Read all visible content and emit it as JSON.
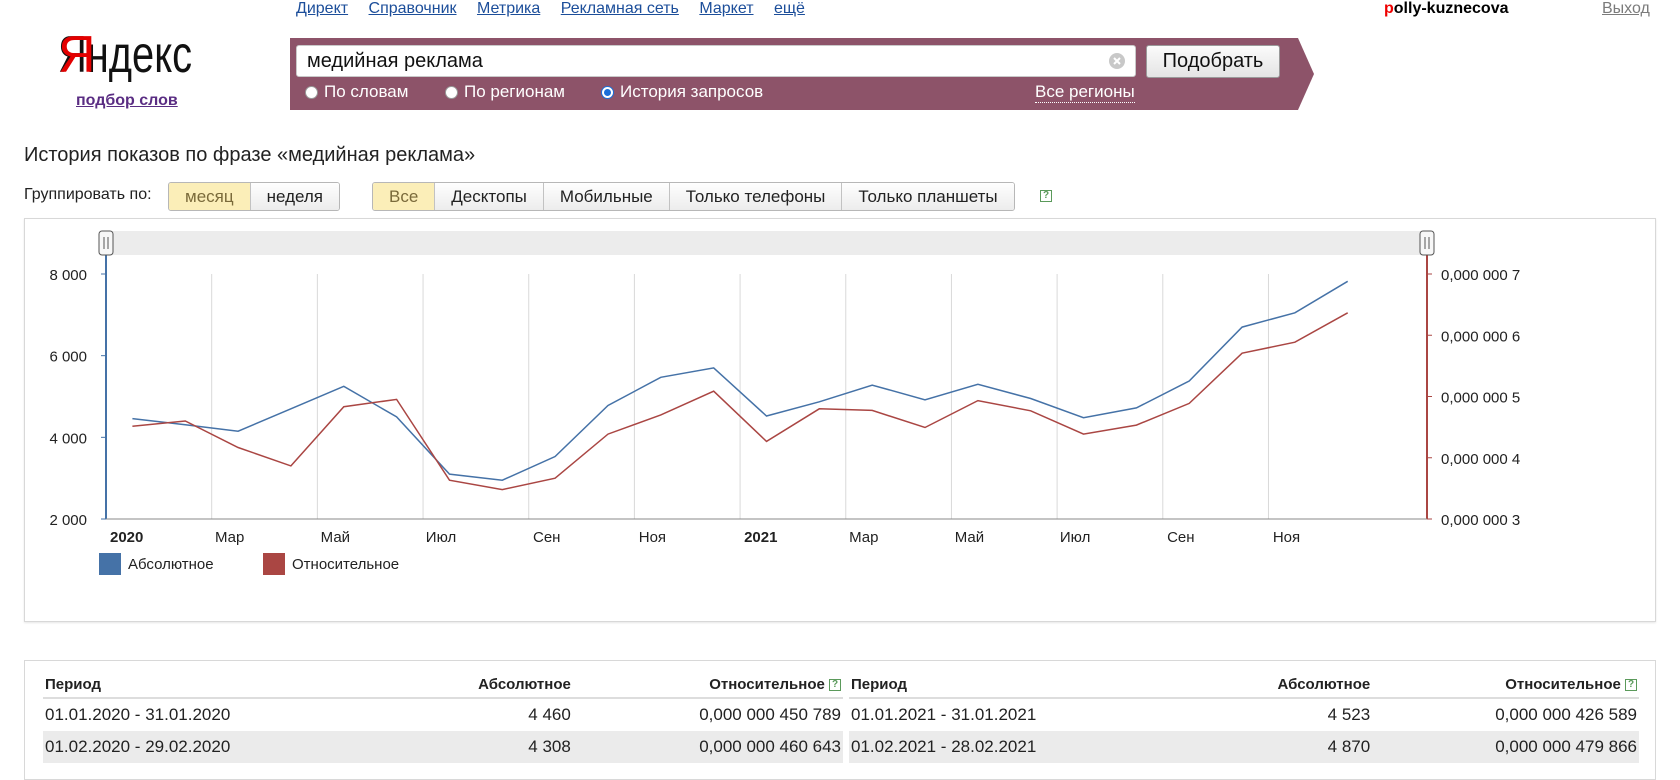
{
  "nav": {
    "links": [
      "Директ",
      "Справочник",
      "Метрика",
      "Рекламная сеть",
      "Маркет",
      "ещё"
    ],
    "user_first_letter": "p",
    "user_rest": "olly-kuznecova",
    "logout": "Выход"
  },
  "logo": {
    "text": "Яндекс",
    "subtitle": "подбор слов"
  },
  "search": {
    "value": "медийная реклама",
    "submit_label": "Подобрать",
    "modes": [
      {
        "label": "По словам",
        "checked": false
      },
      {
        "label": "По регионам",
        "checked": false
      },
      {
        "label": "История запросов",
        "checked": true
      }
    ],
    "regions_link": "Все регионы",
    "band_color": "#8d5369"
  },
  "page": {
    "title": "История показов по фразе «медийная реклама»"
  },
  "filters": {
    "group_label": "Группировать по:",
    "grouping": [
      {
        "label": "месяц",
        "active": true
      },
      {
        "label": "неделя",
        "active": false
      }
    ],
    "devices": [
      {
        "label": "Все",
        "active": true
      },
      {
        "label": "Десктопы",
        "active": false
      },
      {
        "label": "Мобильные",
        "active": false
      },
      {
        "label": "Только телефоны",
        "active": false
      },
      {
        "label": "Только планшеты",
        "active": false
      }
    ],
    "help": "?"
  },
  "chart_data": {
    "type": "line",
    "x": [
      "2020-01",
      "2020-02",
      "2020-03",
      "2020-04",
      "2020-05",
      "2020-06",
      "2020-07",
      "2020-08",
      "2020-09",
      "2020-10",
      "2020-11",
      "2020-12",
      "2021-01",
      "2021-02",
      "2021-03",
      "2021-04",
      "2021-05",
      "2021-06",
      "2021-07",
      "2021-08",
      "2021-09",
      "2021-10",
      "2021-11",
      "2021-12"
    ],
    "x_tick_labels": [
      "2020",
      "Мар",
      "Май",
      "Июл",
      "Сен",
      "Ноя",
      "2021",
      "Мар",
      "Май",
      "Июл",
      "Сен",
      "Ноя"
    ],
    "x_tick_bold": [
      true,
      false,
      false,
      false,
      false,
      false,
      true,
      false,
      false,
      false,
      false,
      false
    ],
    "y_left_ticks": [
      "8 000",
      "6 000",
      "4 000",
      "2 000"
    ],
    "y_left_values": [
      8000,
      6000,
      4000,
      2000
    ],
    "y_right_ticks": [
      "0,000 000 7",
      "0,000 000 6",
      "0,000 000 5",
      "0,000 000 4",
      "0,000 000 3"
    ],
    "y_right_values": [
      7e-07,
      6e-07,
      5e-07,
      4e-07,
      3e-07
    ],
    "ylim_left": [
      2000,
      8000
    ],
    "ylim_right": [
      3e-07,
      7e-07
    ],
    "series": [
      {
        "name": "Абсолютное",
        "axis": "left",
        "color": "#4572a7",
        "values": [
          4460,
          4308,
          4150,
          4700,
          5250,
          4500,
          3100,
          2950,
          3530,
          4780,
          5470,
          5700,
          4523,
          4870,
          5280,
          4920,
          5300,
          4950,
          4480,
          4720,
          5380,
          6700,
          7050,
          7820
        ]
      },
      {
        "name": "Относительное",
        "axis": "left",
        "color": "#aa4643",
        "values": [
          4270,
          4400,
          3750,
          3300,
          4750,
          4930,
          2950,
          2720,
          3000,
          4080,
          4550,
          5130,
          3900,
          4700,
          4660,
          4240,
          4900,
          4650,
          4080,
          4300,
          4830,
          6060,
          6330,
          7050
        ]
      }
    ],
    "legend_position": "bottom-left"
  },
  "table": {
    "headers": {
      "period": "Период",
      "abs": "Абсолютное",
      "rel": "Относительное"
    },
    "left": [
      {
        "period": "01.01.2020 - 31.01.2020",
        "abs": "4 460",
        "rel": "0,000 000 450 789"
      },
      {
        "period": "01.02.2020 - 29.02.2020",
        "abs": "4 308",
        "rel": "0,000 000 460 643"
      }
    ],
    "right": [
      {
        "period": "01.01.2021 - 31.01.2021",
        "abs": "4 523",
        "rel": "0,000 000 426 589"
      },
      {
        "period": "01.02.2021 - 28.02.2021",
        "abs": "4 870",
        "rel": "0,000 000 479 866"
      }
    ]
  }
}
